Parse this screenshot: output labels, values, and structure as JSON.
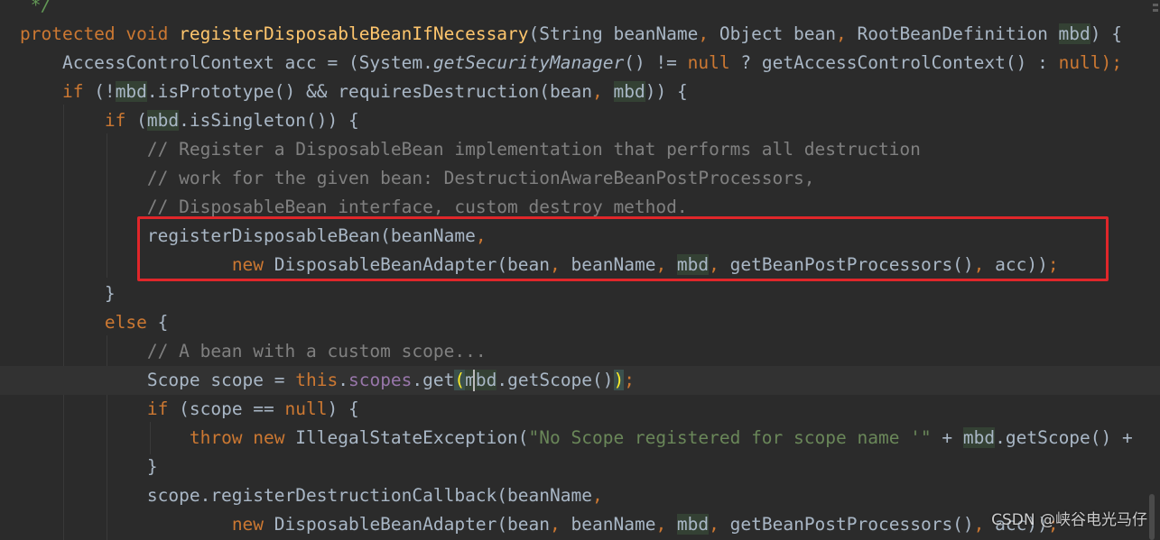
{
  "editor": {
    "lines": [
      [
        {
          "t": " */",
          "c": "doc"
        }
      ],
      [
        {
          "t": "protected void ",
          "c": "kw"
        },
        {
          "t": "registerDisposableBeanIfNecessary",
          "c": "fn"
        },
        {
          "t": "(String beanName",
          "c": ""
        },
        {
          "t": ", ",
          "c": "kw"
        },
        {
          "t": "Object bean",
          "c": ""
        },
        {
          "t": ", ",
          "c": "kw"
        },
        {
          "t": "RootBeanDefinition ",
          "c": ""
        },
        {
          "t": "mbd",
          "c": "par"
        },
        {
          "t": ") {",
          "c": ""
        }
      ],
      [
        {
          "t": "    AccessControlContext acc = (System.",
          "c": ""
        },
        {
          "t": "getSecurityManager",
          "c": "it"
        },
        {
          "t": "() != ",
          "c": ""
        },
        {
          "t": "null",
          "c": "kw"
        },
        {
          "t": " ? getAccessControlContext() : ",
          "c": ""
        },
        {
          "t": "null",
          "c": "kw"
        },
        {
          "t": ");",
          "c": "kw"
        }
      ],
      [
        {
          "t": "    ",
          "c": ""
        },
        {
          "t": "if",
          "c": "kw"
        },
        {
          "t": " (!",
          "c": ""
        },
        {
          "t": "mbd",
          "c": "par"
        },
        {
          "t": ".isPrototype() && requiresDestruction(bean",
          "c": ""
        },
        {
          "t": ", ",
          "c": "kw"
        },
        {
          "t": "mbd",
          "c": "par"
        },
        {
          "t": ")) {",
          "c": ""
        }
      ],
      [
        {
          "t": "        ",
          "c": ""
        },
        {
          "t": "if",
          "c": "kw"
        },
        {
          "t": " (",
          "c": ""
        },
        {
          "t": "mbd",
          "c": "par"
        },
        {
          "t": ".isSingleton()) {",
          "c": ""
        }
      ],
      [
        {
          "t": "            // Register a DisposableBean implementation that performs all destruction",
          "c": "cm"
        }
      ],
      [
        {
          "t": "            // work for the given bean: DestructionAwareBeanPostProcessors,",
          "c": "cm"
        }
      ],
      [
        {
          "t": "            // DisposableBean interface, custom destroy method.",
          "c": "cm"
        }
      ],
      [
        {
          "t": "            registerDisposableBean(beanName",
          "c": ""
        },
        {
          "t": ",",
          "c": "kw"
        }
      ],
      [
        {
          "t": "                    ",
          "c": ""
        },
        {
          "t": "new ",
          "c": "kw"
        },
        {
          "t": "DisposableBeanAdapter(bean",
          "c": ""
        },
        {
          "t": ", ",
          "c": "kw"
        },
        {
          "t": "beanName",
          "c": ""
        },
        {
          "t": ", ",
          "c": "kw"
        },
        {
          "t": "mbd",
          "c": "par"
        },
        {
          "t": ", ",
          "c": "kw"
        },
        {
          "t": "getBeanPostProcessors()",
          "c": ""
        },
        {
          "t": ", ",
          "c": "kw"
        },
        {
          "t": "acc))",
          "c": ""
        },
        {
          "t": ";",
          "c": "kw"
        }
      ],
      [
        {
          "t": "        }",
          "c": ""
        }
      ],
      [
        {
          "t": "        ",
          "c": ""
        },
        {
          "t": "else ",
          "c": "kw"
        },
        {
          "t": "{",
          "c": ""
        }
      ],
      [
        {
          "t": "            // A bean with a custom scope...",
          "c": "cm"
        }
      ],
      [
        {
          "t": "            Scope scope = ",
          "c": ""
        },
        {
          "t": "this",
          "c": "kw"
        },
        {
          "t": ".",
          "c": ""
        },
        {
          "t": "scopes",
          "c": "fld"
        },
        {
          "t": ".get",
          "c": ""
        },
        {
          "t": "(",
          "c": "brace-hl"
        },
        {
          "t": "mbd",
          "c": "par"
        },
        {
          "t": ".getScope()",
          "c": ""
        },
        {
          "t": ")",
          "c": "brace-hl"
        },
        {
          "t": ";",
          "c": "kw"
        }
      ],
      [
        {
          "t": "            ",
          "c": ""
        },
        {
          "t": "if",
          "c": "kw"
        },
        {
          "t": " (scope == ",
          "c": ""
        },
        {
          "t": "null",
          "c": "kw"
        },
        {
          "t": ") {",
          "c": ""
        }
      ],
      [
        {
          "t": "                ",
          "c": ""
        },
        {
          "t": "throw new ",
          "c": "kw"
        },
        {
          "t": "IllegalStateException(",
          "c": ""
        },
        {
          "t": "\"No Scope registered for scope name '\"",
          "c": "str"
        },
        {
          "t": " + ",
          "c": ""
        },
        {
          "t": "mbd",
          "c": "par"
        },
        {
          "t": ".getScope() +",
          "c": ""
        }
      ],
      [
        {
          "t": "            }",
          "c": ""
        }
      ],
      [
        {
          "t": "            scope.registerDestructionCallback(beanName",
          "c": ""
        },
        {
          "t": ",",
          "c": "kw"
        }
      ],
      [
        {
          "t": "                    ",
          "c": ""
        },
        {
          "t": "new ",
          "c": "kw"
        },
        {
          "t": "DisposableBeanAdapter(bean",
          "c": ""
        },
        {
          "t": ", ",
          "c": "kw"
        },
        {
          "t": "beanName",
          "c": ""
        },
        {
          "t": ", ",
          "c": "kw"
        },
        {
          "t": "mbd",
          "c": "par"
        },
        {
          "t": ", ",
          "c": "kw"
        },
        {
          "t": "getBeanPostProcessors()",
          "c": ""
        },
        {
          "t": ", ",
          "c": "kw"
        },
        {
          "t": "acc))",
          "c": ""
        },
        {
          "t": ";",
          "c": "kw"
        }
      ]
    ],
    "current_line": 13
  },
  "watermark": "CSDN @峡谷电光马仔",
  "colors": {
    "background": "#2b2b2b",
    "keyword": "#cc7832",
    "method": "#ffc66d",
    "comment": "#808080",
    "string": "#6a8759",
    "field": "#9876aa",
    "highlight_box": "#e0262a"
  }
}
